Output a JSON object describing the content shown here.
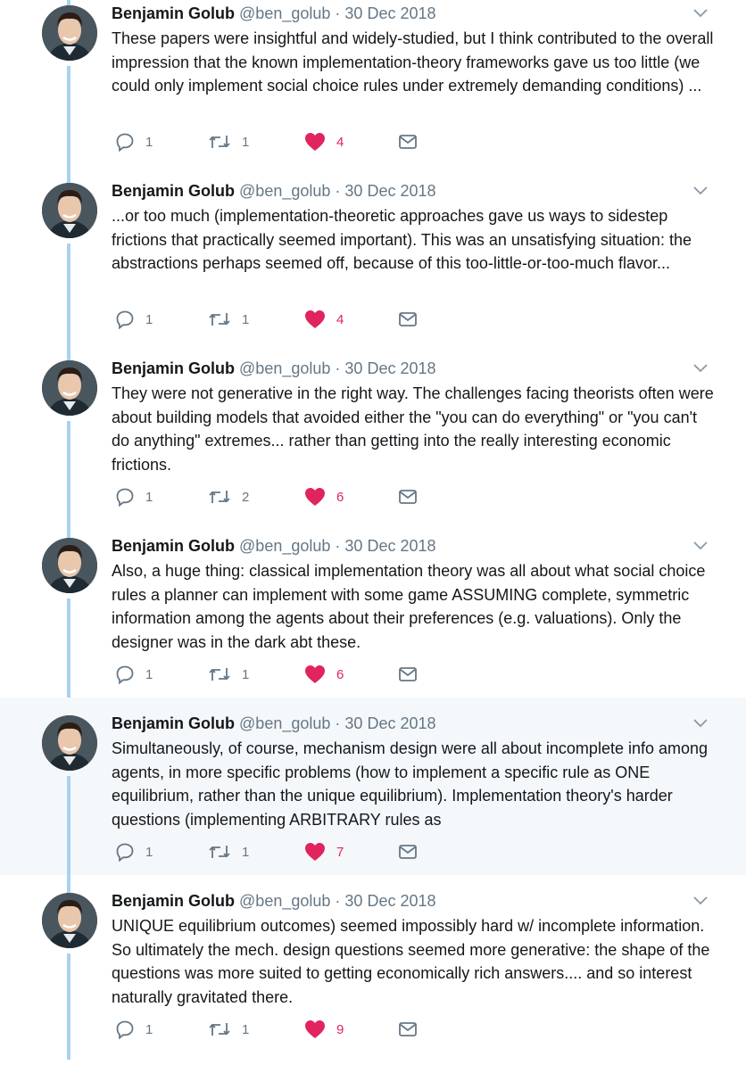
{
  "colors": {
    "thread_line": "#a9d2ef",
    "like": "#e0245e",
    "meta_gray": "#657786",
    "highlight_bg": "#f5f8fa"
  },
  "icons": [
    "avatar-photo",
    "chevron-down-icon",
    "reply-icon",
    "retweet-icon",
    "heart-icon",
    "envelope-icon"
  ],
  "tweets": [
    {
      "name": "Benjamin Golub",
      "handle": "@ben_golub",
      "separator": "·",
      "date": "30 Dec 2018",
      "text": "These papers were insightful and widely-studied, but I think contributed to the overall impression that the known implementation-theory frameworks gave us too little (we could only implement social choice rules under extremely demanding conditions) ...",
      "replies": "1",
      "retweets": "1",
      "likes": "4"
    },
    {
      "name": "Benjamin Golub",
      "handle": "@ben_golub",
      "separator": "·",
      "date": "30 Dec 2018",
      "text": "...or too much (implementation-theoretic approaches gave us ways to sidestep frictions that practically seemed important). This was an unsatisfying situation: the abstractions perhaps seemed off, because of this too-little-or-too-much flavor...",
      "replies": "1",
      "retweets": "1",
      "likes": "4"
    },
    {
      "name": "Benjamin Golub",
      "handle": "@ben_golub",
      "separator": "·",
      "date": "30 Dec 2018",
      "text": "They were not generative in the right way. The challenges facing theorists often were about building models that avoided either the \"you can do everything\" or \"you can't do anything\" extremes... rather than getting into the really interesting economic frictions.",
      "replies": "1",
      "retweets": "2",
      "likes": "6"
    },
    {
      "name": "Benjamin Golub",
      "handle": "@ben_golub",
      "separator": "·",
      "date": "30 Dec 2018",
      "text": "Also, a huge thing: classical implementation theory was all about what social choice rules a planner can implement with some game ASSUMING complete, symmetric information among the agents about their preferences (e.g. valuations). Only the designer was in the dark abt these.",
      "replies": "1",
      "retweets": "1",
      "likes": "6"
    },
    {
      "name": "Benjamin Golub",
      "handle": "@ben_golub",
      "separator": "·",
      "date": "30 Dec 2018",
      "text": "Simultaneously, of course, mechanism design were all about incomplete info among agents, in more specific problems (how to implement a specific rule as ONE equilibrium, rather than the unique equilibrium). Implementation theory's harder questions (implementing ARBITRARY rules as",
      "replies": "1",
      "retweets": "1",
      "likes": "7"
    },
    {
      "name": "Benjamin Golub",
      "handle": "@ben_golub",
      "separator": "·",
      "date": "30 Dec 2018",
      "text": "UNIQUE equilibrium outcomes) seemed impossibly hard w/ incomplete information. So ultimately the mech. design questions seemed more generative: the shape of the questions was more suited to getting economically rich answers.... and so interest naturally gravitated there.",
      "replies": "1",
      "retweets": "1",
      "likes": "9"
    }
  ]
}
